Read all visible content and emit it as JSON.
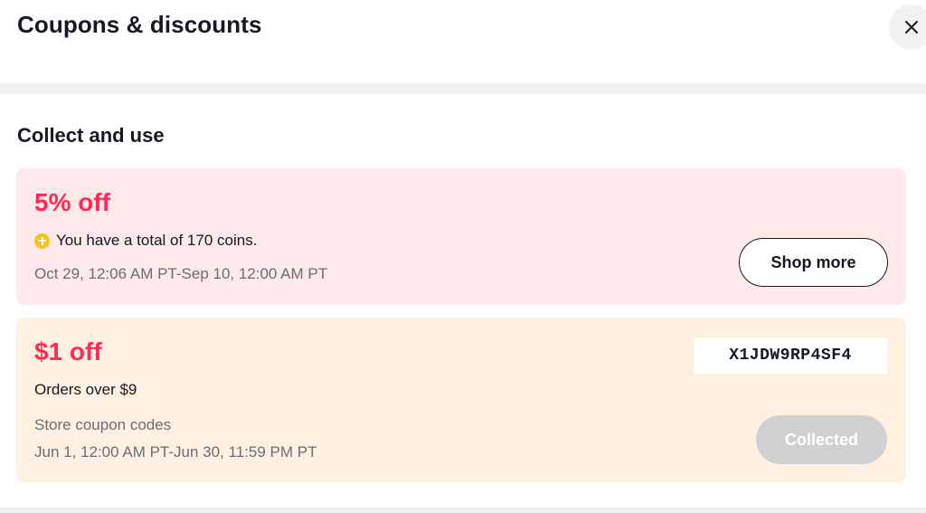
{
  "header": {
    "title": "Coupons & discounts",
    "close_icon": "close-icon"
  },
  "section": {
    "title": "Collect and use"
  },
  "coupons": [
    {
      "discount": "5% off",
      "coin_icon": "coin-icon",
      "coins_text": "You have a total of 170 coins.",
      "validity": "Oct 29, 12:06 AM PT-Sep 10, 12:00 AM PT",
      "action_label": "Shop more",
      "background": "#fde8ea"
    },
    {
      "discount": "$1 off",
      "condition": "Orders over $9",
      "type": "Store coupon codes",
      "validity": "Jun 1, 12:00 AM PT-Jun 30, 11:59 PM PT",
      "code": "X1JDW9RP4SF4",
      "status_label": "Collected",
      "background": "#fff0e1"
    }
  ],
  "colors": {
    "accent": "#fe2c55",
    "coin": "#f7c21b",
    "disabled": "#d0d0d3"
  }
}
